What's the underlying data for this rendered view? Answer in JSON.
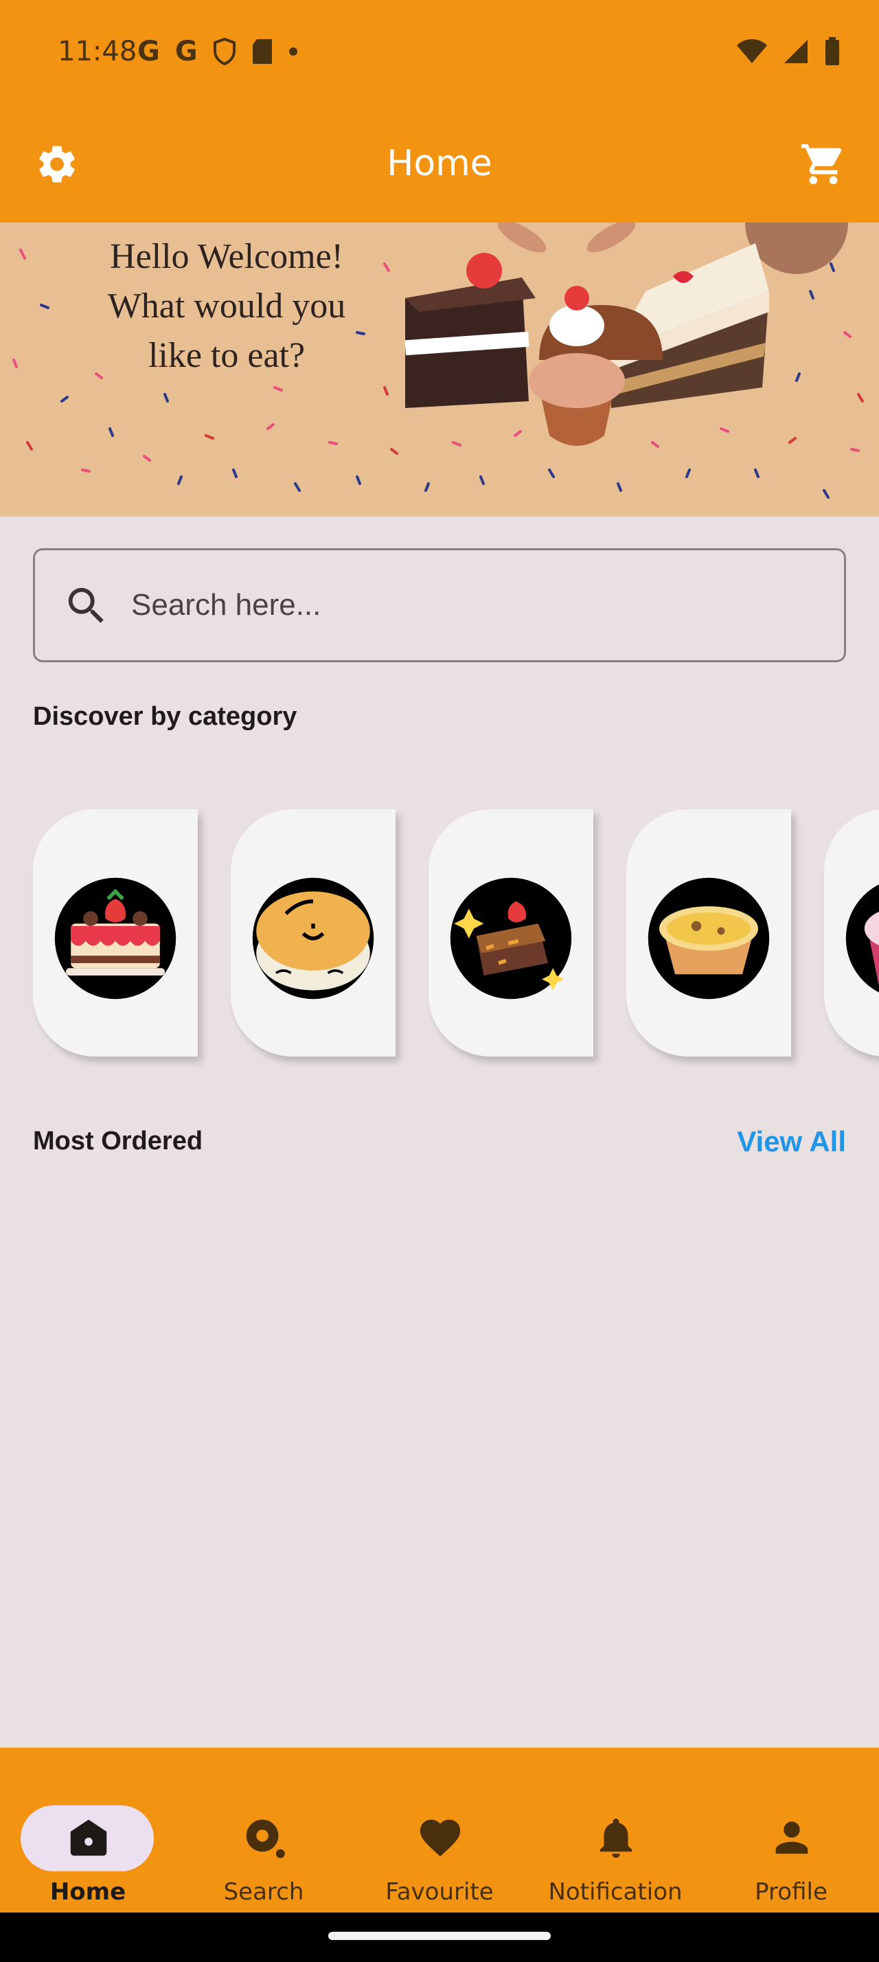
{
  "status_bar": {
    "time": "11:48",
    "left_icons": [
      "google-icon",
      "google-icon",
      "shield-icon",
      "sd-card-icon",
      "dot-icon"
    ],
    "right_icons": [
      "wifi-icon",
      "signal-icon",
      "battery-icon"
    ]
  },
  "app_bar": {
    "title": "Home",
    "left_icon": "gear-icon",
    "right_icon": "cart-icon"
  },
  "banner": {
    "line1": "Hello Welcome!",
    "line2": "What would you",
    "line3": "like to eat?"
  },
  "search": {
    "placeholder": "Search here..."
  },
  "categories_section": {
    "title": "Discover by category",
    "items": [
      {
        "icon": "cake-icon"
      },
      {
        "icon": "bun-icon"
      },
      {
        "icon": "brownie-icon"
      },
      {
        "icon": "egg-tart-icon"
      },
      {
        "icon": "cupcake-icon"
      }
    ]
  },
  "most_ordered": {
    "title": "Most Ordered",
    "view_all": "View All"
  },
  "bottom_nav": {
    "items": [
      {
        "label": "Home",
        "icon": "home-icon",
        "active": true
      },
      {
        "label": "Search",
        "icon": "search-location-icon",
        "active": false
      },
      {
        "label": "Favourite",
        "icon": "heart-icon",
        "active": false
      },
      {
        "label": "Notification",
        "icon": "bell-icon",
        "active": false
      },
      {
        "label": "Profile",
        "icon": "person-icon",
        "active": false
      }
    ]
  },
  "colors": {
    "primary": "#f29312",
    "background": "#e8e0e1",
    "link": "#2196e8",
    "active_pill": "#ece0f0"
  }
}
